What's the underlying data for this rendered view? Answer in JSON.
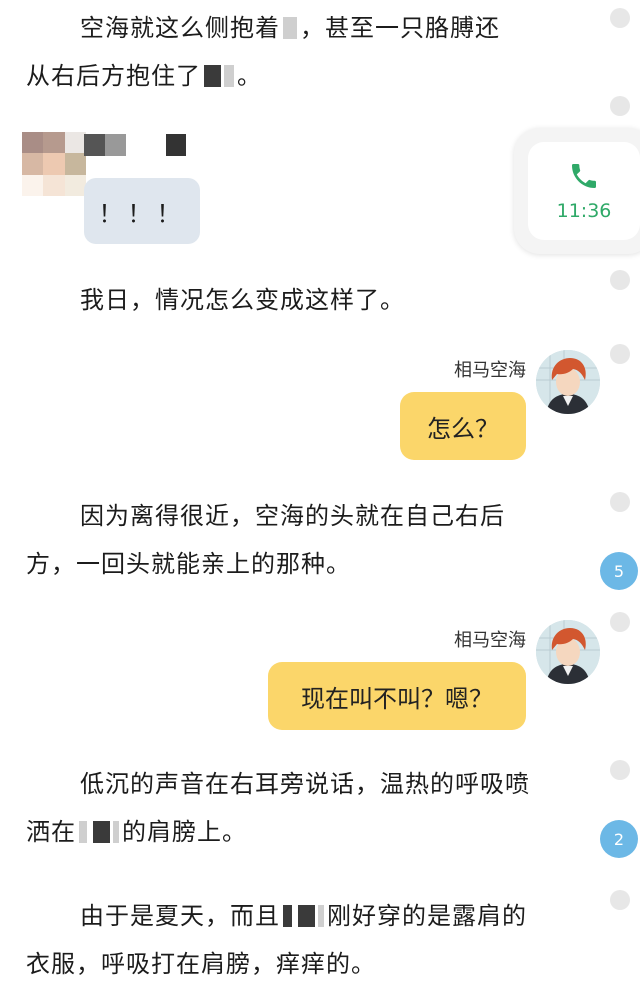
{
  "paragraphs": {
    "p1": {
      "line1_a": "空海就这么侧抱着",
      "line1_b": "，甚至一只胳膊还",
      "line2_a": "从右后方抱住了",
      "line2_b": "。"
    },
    "p2": {
      "line1": "我日，情况怎么变成这样了。"
    },
    "p3": {
      "line1": "因为离得很近，空海的头就在自己右后",
      "line2": "方，一回头就能亲上的那种。"
    },
    "p4": {
      "line1": "低沉的声音在右耳旁说话，温热的呼吸喷",
      "line2_a": "洒在",
      "line2_b": "的肩膀上。"
    },
    "p5": {
      "line1_a": "由于是夏天，而且",
      "line1_b": "刚好穿的是露肩的",
      "line2": "衣服，呼吸打在肩膀，痒痒的。"
    }
  },
  "chat": {
    "grey_bubble": "！！！",
    "speaker_name_1": "相马空海",
    "bubble_1": "怎么？",
    "speaker_name_2": "相马空海",
    "bubble_2": "现在叫不叫？嗯？"
  },
  "call_card": {
    "time": "11:36",
    "icon": "phone-icon"
  },
  "comment_badges": [
    "5",
    "2"
  ],
  "colors": {
    "bubble_yellow": "#fbd66a",
    "bubble_grey": "#dfe6ee",
    "call_green": "#2fa968",
    "badge_blue": "#6cb8e6"
  }
}
